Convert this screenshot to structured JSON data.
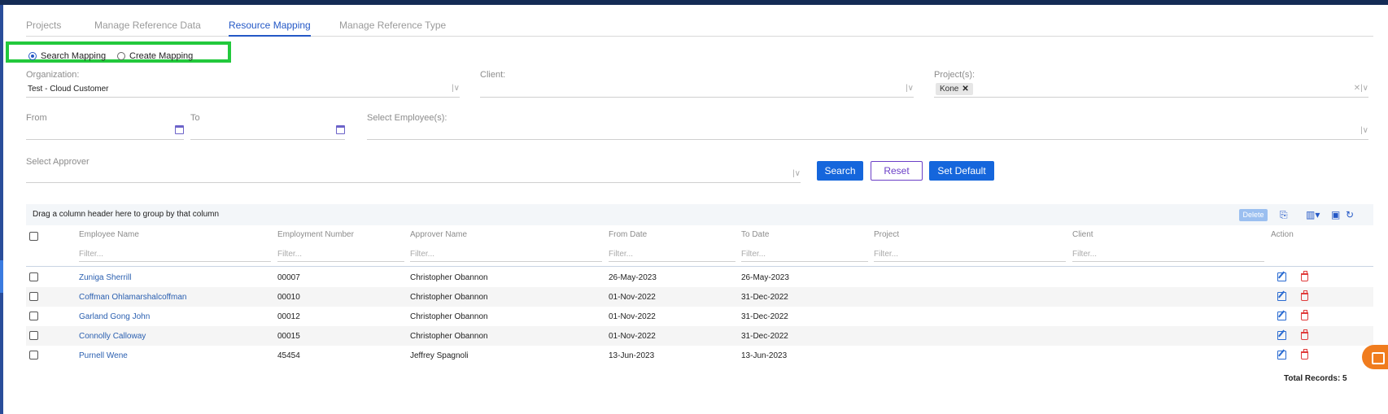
{
  "tabs": [
    {
      "label": "Projects"
    },
    {
      "label": "Manage Reference Data"
    },
    {
      "label": "Resource Mapping"
    },
    {
      "label": "Manage Reference Type"
    }
  ],
  "mode": {
    "search_label": "Search Mapping",
    "create_label": "Create Mapping",
    "selected": "Search Mapping"
  },
  "form": {
    "organization_label": "Organization:",
    "organization_value": "Test - Cloud Customer",
    "client_label": "Client:",
    "client_value": "",
    "projects_label": "Project(s):",
    "project_chip": "Kone",
    "from_label": "From",
    "to_label": "To",
    "employees_label": "Select Employee(s):",
    "approver_label": "Select Approver"
  },
  "buttons": {
    "search": "Search",
    "reset": "Reset",
    "set_default": "Set Default"
  },
  "grid": {
    "group_hint": "Drag a column header here to group by that column",
    "delete_label": "Delete",
    "columns": [
      "Employee Name",
      "Employment Number",
      "Approver Name",
      "From Date",
      "To Date",
      "Project",
      "Client",
      "Action"
    ],
    "filter_placeholder": "Filter...",
    "rows": [
      {
        "employee": "Zuniga Sherrill",
        "number": "00007",
        "approver": "Christopher Obannon",
        "from": "26-May-2023",
        "to": "26-May-2023",
        "project": "",
        "client": ""
      },
      {
        "employee": "Coffman Ohlamarshalcoffman",
        "number": "00010",
        "approver": "Christopher Obannon",
        "from": "01-Nov-2022",
        "to": "31-Dec-2022",
        "project": "",
        "client": ""
      },
      {
        "employee": "Garland Gong John",
        "number": "00012",
        "approver": "Christopher Obannon",
        "from": "01-Nov-2022",
        "to": "31-Dec-2022",
        "project": "",
        "client": ""
      },
      {
        "employee": "Connolly Calloway",
        "number": "00015",
        "approver": "Christopher Obannon",
        "from": "01-Nov-2022",
        "to": "31-Dec-2022",
        "project": "",
        "client": ""
      },
      {
        "employee": "Purnell Wene",
        "number": "45454",
        "approver": "Jeffrey Spagnoli",
        "from": "13-Jun-2023",
        "to": "13-Jun-2023",
        "project": "",
        "client": ""
      }
    ],
    "total_records": "Total Records: 5"
  },
  "colors": {
    "accent": "#2458c6",
    "primary_button": "#1566dc",
    "highlight": "#22c93c",
    "delete_icon": "#e03b3b",
    "help_fab": "#f07c1e"
  }
}
